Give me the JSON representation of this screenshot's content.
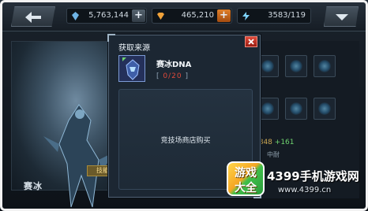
{
  "topbar": {
    "crystal": {
      "value": "5,763,144",
      "icon": "crystal-icon",
      "plus": "+"
    },
    "gem": {
      "value": "465,210",
      "icon": "gem-icon",
      "plus": "+"
    },
    "energy": {
      "value": "3583/119",
      "icon": "energy-icon"
    }
  },
  "background": {
    "hero_name": "赛冰",
    "tag": "技能",
    "stat": "4848",
    "stat_extra": "+161",
    "stat2": "中耐"
  },
  "modal": {
    "title": "获取来源",
    "close_icon": "close-icon",
    "item": {
      "name": "赛冰DNA",
      "count_open": "[",
      "count_current": "0",
      "count_sep": "/",
      "count_required": "20",
      "count_close": "]"
    },
    "source": "竞技场商店购买"
  },
  "watermark": {
    "logo_line1": "游戏",
    "logo_line2": "大全",
    "title": "4399手机游戏网",
    "url": "www.4399.cn"
  },
  "colors": {
    "accent_red": "#e0493a",
    "plus_orange": "#e0802a",
    "panel": "#1c2733"
  }
}
